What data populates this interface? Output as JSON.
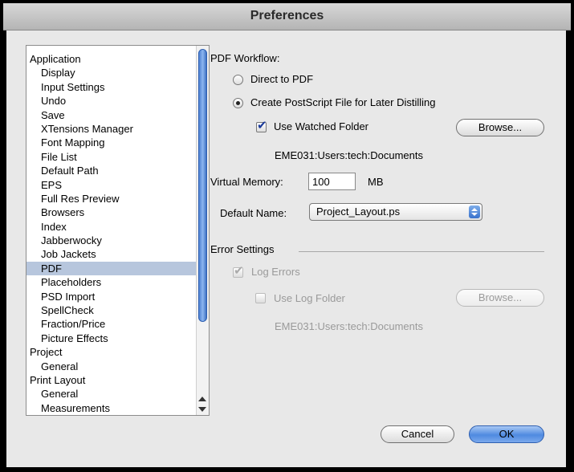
{
  "window": {
    "title": "Preferences"
  },
  "sidebar": {
    "items": [
      {
        "label": "Application",
        "level": 0
      },
      {
        "label": "Display",
        "level": 1
      },
      {
        "label": "Input Settings",
        "level": 1
      },
      {
        "label": "Undo",
        "level": 1
      },
      {
        "label": "Save",
        "level": 1
      },
      {
        "label": "XTensions Manager",
        "level": 1
      },
      {
        "label": "Font Mapping",
        "level": 1
      },
      {
        "label": "File List",
        "level": 1
      },
      {
        "label": "Default Path",
        "level": 1
      },
      {
        "label": "EPS",
        "level": 1
      },
      {
        "label": "Full Res Preview",
        "level": 1
      },
      {
        "label": "Browsers",
        "level": 1
      },
      {
        "label": "Index",
        "level": 1
      },
      {
        "label": "Jabberwocky",
        "level": 1
      },
      {
        "label": "Job Jackets",
        "level": 1
      },
      {
        "label": "PDF",
        "level": 1,
        "selected": true
      },
      {
        "label": "Placeholders",
        "level": 1
      },
      {
        "label": "PSD Import",
        "level": 1
      },
      {
        "label": "SpellCheck",
        "level": 1
      },
      {
        "label": "Fraction/Price",
        "level": 1
      },
      {
        "label": "Picture Effects",
        "level": 1
      },
      {
        "label": "Project",
        "level": 0
      },
      {
        "label": "General",
        "level": 1
      },
      {
        "label": "Print Layout",
        "level": 0
      },
      {
        "label": "General",
        "level": 1
      },
      {
        "label": "Measurements",
        "level": 1
      }
    ]
  },
  "pdf": {
    "workflow_label": "PDF Workflow:",
    "direct_label": "Direct to PDF",
    "postscript_label": "Create PostScript File for Later Distilling",
    "watched_folder_label": "Use Watched Folder",
    "browse_label": "Browse...",
    "watched_path": "EME031:Users:tech:Documents",
    "vm_label": "Virtual Memory:",
    "vm_value": "100",
    "vm_unit": "MB",
    "default_name_label": "Default Name:",
    "default_name_value": "Project_Layout.ps"
  },
  "errors": {
    "section_label": "Error Settings",
    "log_errors_label": "Log Errors",
    "use_log_folder_label": "Use Log Folder",
    "browse_label": "Browse...",
    "log_path": "EME031:Users:tech:Documents"
  },
  "buttons": {
    "cancel": "Cancel",
    "ok": "OK"
  }
}
